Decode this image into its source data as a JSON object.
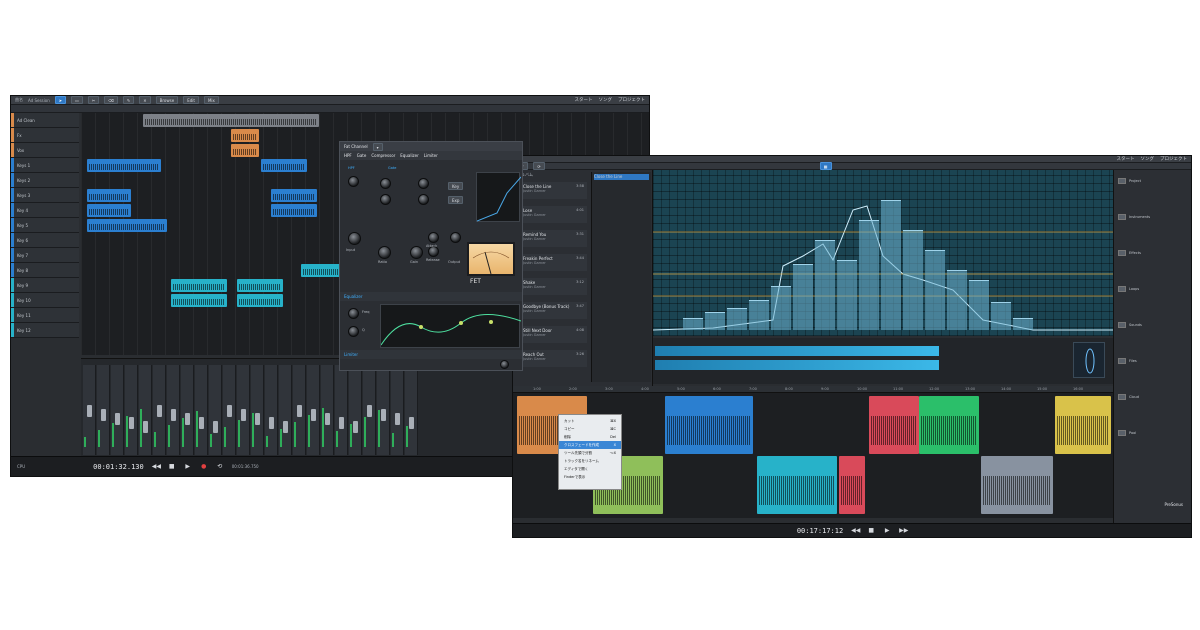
{
  "window1": {
    "title": "曲名",
    "song": "Ad Session",
    "toolbar_labels": [
      "Browse",
      "Edit",
      "Mix"
    ],
    "menu": [
      "スタート",
      "ソング",
      "プロジェクト"
    ],
    "tracks": [
      {
        "name": "Ad Clean",
        "color": "#d98a4a"
      },
      {
        "name": "Fx",
        "color": "#d98a4a"
      },
      {
        "name": "Vox",
        "color": "#d98a4a"
      },
      {
        "name": "Keys 1",
        "color": "#2b7fd0"
      },
      {
        "name": "Keys 2",
        "color": "#2b7fd0"
      },
      {
        "name": "Keys 3",
        "color": "#2b7fd0"
      },
      {
        "name": "Key 4",
        "color": "#2b7fd0"
      },
      {
        "name": "Key 5",
        "color": "#2b7fd0"
      },
      {
        "name": "Key 6",
        "color": "#2b7fd0"
      },
      {
        "name": "Key 7",
        "color": "#2b7fd0"
      },
      {
        "name": "Key 8",
        "color": "#2b7fd0"
      },
      {
        "name": "Key 9",
        "color": "#27b2c9"
      },
      {
        "name": "Key 10",
        "color": "#27b2c9"
      },
      {
        "name": "Key 11",
        "color": "#27b2c9"
      },
      {
        "name": "Key 12",
        "color": "#27b2c9"
      }
    ],
    "plugin": {
      "title": "Fat Channel",
      "sections": [
        "HPF",
        "Gate",
        "Compressor",
        "Equalizer",
        "Limiter"
      ],
      "model": "FET",
      "knob_labels": [
        "Input",
        "Output",
        "Attack",
        "Release",
        "Ratio",
        "Gain",
        "Freq",
        "Q"
      ]
    },
    "mixer_channels": 24,
    "timecode": "00:01:32.130",
    "time_small": "00:01:36.750"
  },
  "window2": {
    "menu": [
      "スタート",
      "ソング",
      "プロジェクト"
    ],
    "browser_header": "アルバム",
    "songs": [
      {
        "title": "Close the Line",
        "artist": "Justin Garner",
        "dur": "3:58",
        "color": "#d98a4a"
      },
      {
        "title": "Lose",
        "artist": "Justin Garner",
        "dur": "4:01",
        "color": "#8fbf5a"
      },
      {
        "title": "Remind You",
        "artist": "Justin Garner",
        "dur": "3:31",
        "color": "#2b7fd0"
      },
      {
        "title": "Freakin Perfect",
        "artist": "Justin Garner",
        "dur": "3:44",
        "color": "#d94a5a"
      },
      {
        "title": "Shake",
        "artist": "Justin Garner",
        "dur": "3:12",
        "color": "#27b2c9"
      },
      {
        "title": "Goodbye (Bonus Track)",
        "artist": "Justin Garner",
        "dur": "3:47",
        "color": "#d94a5a"
      },
      {
        "title": "Still Next Door",
        "artist": "Justin Garner",
        "dur": "4:08",
        "color": "#2bbf6a"
      },
      {
        "title": "Reach Out",
        "artist": "Justin Garner",
        "dur": "3:26",
        "color": "#8892a0"
      }
    ],
    "context_menu": [
      {
        "label": "カット",
        "key": "⌘X"
      },
      {
        "label": "コピー",
        "key": "⌘C"
      },
      {
        "label": "削除",
        "key": "Del"
      },
      {
        "label": "クロスフェードを作成",
        "key": "X"
      },
      {
        "label": "ツール先頭で分割",
        "key": "⌥X"
      },
      {
        "label": "トラック名をリネーム",
        "key": ""
      },
      {
        "label": "エディタで開く",
        "key": ""
      },
      {
        "label": "Finderで表示",
        "key": ""
      }
    ],
    "browser_items": [
      "Project",
      "Instruments",
      "Effects",
      "Loops",
      "Sounds",
      "Files",
      "Cloud",
      "Pool"
    ],
    "ruler_marks": [
      "1:00",
      "2:00",
      "3:00",
      "4:00",
      "5:00",
      "6:00",
      "7:00",
      "8:00",
      "9:00",
      "10:00",
      "11:00",
      "12:00",
      "13:00",
      "14:00",
      "15:00",
      "16:00"
    ],
    "timecode": "00:17:17:12",
    "logo_text": "PreSonus"
  }
}
